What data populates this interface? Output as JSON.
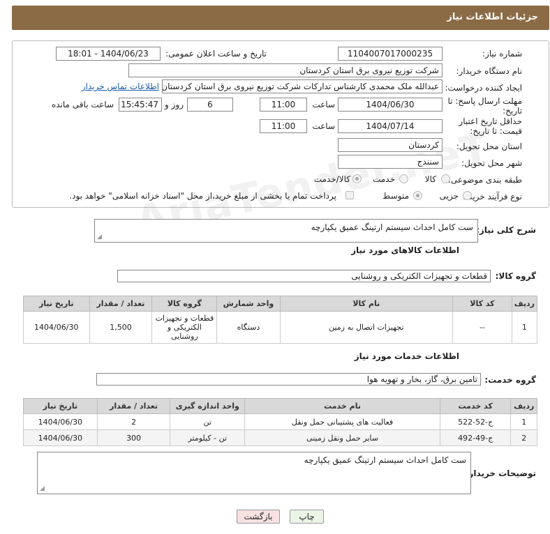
{
  "page_title": "جزئیات اطلاعات نیاز",
  "need_number": {
    "label": "شماره نیاز:",
    "value": "1104007017000235"
  },
  "announce": {
    "label": "تاریخ و ساعت اعلان عمومی:",
    "value": "1404/06/23 - 18:01"
  },
  "buyer_org": {
    "label": "نام دستگاه خریدار:",
    "value": "شرکت توزیع نیروی برق استان کردستان"
  },
  "requester": {
    "label": "ایجاد کننده درخواست:",
    "value": "عبدالله ملک محمدی کارشناس تدارکات شرکت توزیع نیروی برق استان کردستان",
    "contact_link": "اطلاعات تماس خریدار"
  },
  "deadline": {
    "label": "مهلت ارسال پاسخ: تا تاریخ:",
    "date": "1404/06/30",
    "time_label": "ساعت",
    "time": "11:00",
    "days": "6",
    "days_label": "روز و",
    "remaining": "15:45:47",
    "remaining_label": "ساعت باقی مانده"
  },
  "validity": {
    "label": "حداقل تاریخ اعتبار قیمت: تا تاریخ:",
    "date": "1404/07/14",
    "time_label": "ساعت",
    "time": "11:00"
  },
  "province": {
    "label": "استان محل تحویل:",
    "value": "کردستان"
  },
  "city": {
    "label": "شهر محل تحویل:",
    "value": "سنندج"
  },
  "category": {
    "label": "طبقه بندی موضوعی:",
    "options": [
      "کالا",
      "خدمت",
      "کالا/خدمت"
    ],
    "selected": "کالا/خدمت"
  },
  "process": {
    "label": "نوع فرآیند خرید :",
    "options": [
      "جزیی",
      "متوسط"
    ],
    "selected": "متوسط",
    "payment_note": "پرداخت تمام یا بخشی از مبلغ خرید،از محل \"اسناد خزانه اسلامی\" خواهد بود."
  },
  "description": {
    "label": "شرح کلی نیاز:",
    "value": "ست کامل احداث سیستم ارتینگ عمیق یکپارچه"
  },
  "goods": {
    "section_title": "اطلاعات کالاهای مورد نیاز",
    "group_label": "گروه کالا:",
    "group_value": "قطعات و تجهیزات الکتریکی و روشنایی",
    "headers": [
      "ردیف",
      "کد کالا",
      "نام کالا",
      "واحد شمارش",
      "گروه کالا",
      "تعداد / مقدار",
      "تاریخ نیاز"
    ],
    "rows": [
      [
        "1",
        "--",
        "تجهیزات اتصال به زمین",
        "دستگاه",
        "قطعات و تجهیزات الکتریکی و روشنایی",
        "1,500",
        "1404/06/30"
      ]
    ]
  },
  "services": {
    "section_title": "اطلاعات خدمات مورد نیاز",
    "group_label": "گروه خدمت:",
    "group_value": "تامین برق، گاز، بخار و تهویه هوا",
    "headers": [
      "ردیف",
      "کد خدمت",
      "نام خدمت",
      "واحد اندازه گیری",
      "تعداد / مقدار",
      "تاریخ نیاز"
    ],
    "rows": [
      [
        "1",
        "ج-52-522",
        "فعالیت های پشتیبانی حمل ونقل",
        "تن",
        "2",
        "1404/06/30"
      ],
      [
        "2",
        "ج-49-492",
        "سایر حمل ونقل زمینی",
        "تن - کیلومتر",
        "300",
        "1404/06/30"
      ]
    ]
  },
  "buyer_notes": {
    "label": "توضیحات خریدار:",
    "value": "ست کامل احداث سیستم ارتینگ عمیق یکپارچه"
  },
  "buttons": {
    "print": "چاپ",
    "back": "بازگشت"
  },
  "watermark": "AriaTender.neT"
}
